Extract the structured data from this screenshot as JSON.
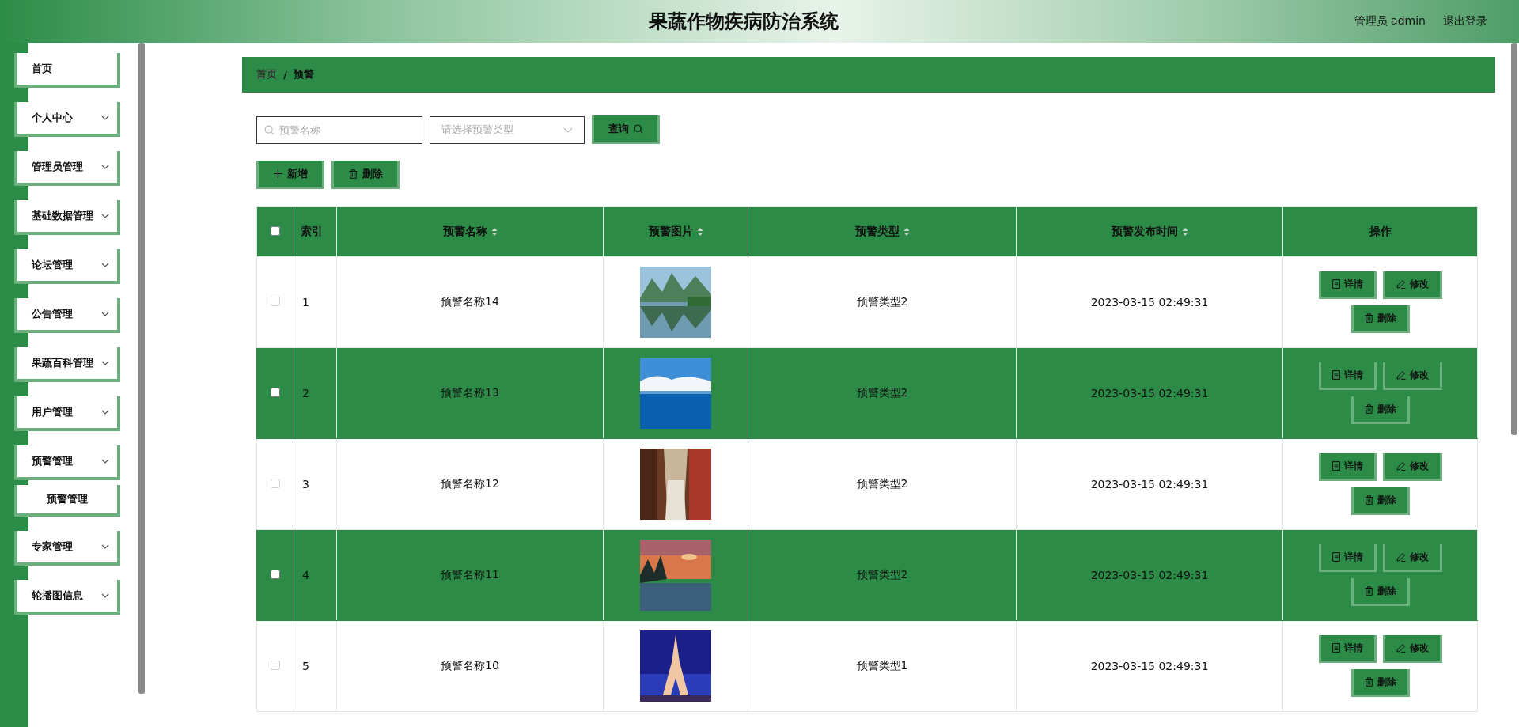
{
  "header": {
    "title": "果蔬作物疾病防治系统",
    "user": "管理员 admin",
    "logout": "退出登录"
  },
  "sidebar": {
    "items": [
      {
        "label": "首页",
        "has_arrow": false,
        "expanded": false
      },
      {
        "label": "个人中心",
        "has_arrow": true,
        "expanded": false
      },
      {
        "label": "管理员管理",
        "has_arrow": true,
        "expanded": false
      },
      {
        "label": "基础数据管理",
        "has_arrow": true,
        "expanded": false
      },
      {
        "label": "论坛管理",
        "has_arrow": true,
        "expanded": false
      },
      {
        "label": "公告管理",
        "has_arrow": true,
        "expanded": false
      },
      {
        "label": "果蔬百科管理",
        "has_arrow": true,
        "expanded": false
      },
      {
        "label": "用户管理",
        "has_arrow": true,
        "expanded": false
      },
      {
        "label": "预警管理",
        "has_arrow": true,
        "expanded": true,
        "children": [
          {
            "label": "预警管理"
          }
        ]
      },
      {
        "label": "专家管理",
        "has_arrow": true,
        "expanded": false
      },
      {
        "label": "轮播图信息",
        "has_arrow": true,
        "expanded": false
      }
    ]
  },
  "breadcrumb": {
    "items": [
      "首页",
      "预警"
    ],
    "separators": [
      "/"
    ]
  },
  "search": {
    "name_placeholder": "预警名称",
    "type_placeholder": "请选择预警类型",
    "button": "查询"
  },
  "actions": [
    "新增",
    "删除"
  ],
  "table": {
    "all_checked": false,
    "columns": [
      {
        "label": "索引",
        "sortable": false
      },
      {
        "label": "预警名称",
        "sortable": true
      },
      {
        "label": "预警图片",
        "sortable": true
      },
      {
        "label": "预警类型",
        "sortable": true
      },
      {
        "label": "预警发布时间",
        "sortable": true
      },
      {
        "label": "操作",
        "sortable": false
      }
    ],
    "rows": [
      {
        "checked": false,
        "index": "1",
        "name": "预警名称14",
        "type": "预警类型2",
        "time": "2023-03-15 02:49:31",
        "buttons": [
          "详情",
          "修改",
          "删除"
        ]
      },
      {
        "checked": false,
        "index": "2",
        "name": "预警名称13",
        "type": "预警类型2",
        "time": "2023-03-15 02:49:31",
        "buttons": [
          "详情",
          "修改",
          "删除"
        ]
      },
      {
        "checked": false,
        "index": "3",
        "name": "预警名称12",
        "type": "预警类型2",
        "time": "2023-03-15 02:49:31",
        "buttons": [
          "详情",
          "修改",
          "删除"
        ]
      },
      {
        "checked": false,
        "index": "4",
        "name": "预警名称11",
        "type": "预警类型2",
        "time": "2023-03-15 02:49:31",
        "buttons": [
          "详情",
          "修改",
          "删除"
        ]
      },
      {
        "checked": false,
        "index": "5",
        "name": "预警名称10",
        "type": "预警类型1",
        "time": "2023-03-15 02:49:31",
        "buttons": [
          "详情",
          "修改",
          "删除"
        ]
      }
    ]
  }
}
